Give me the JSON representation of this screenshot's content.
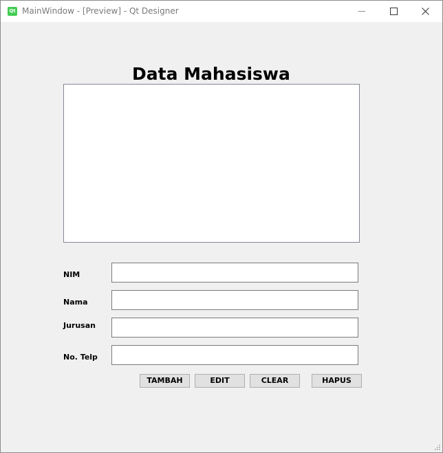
{
  "window": {
    "title": "MainWindow - [Preview] - Qt Designer",
    "app_icon_text": "Qt"
  },
  "form": {
    "heading": "Data Mahasiswa",
    "fields": [
      {
        "label": "NIM",
        "value": ""
      },
      {
        "label": "Nama",
        "value": ""
      },
      {
        "label": "Jurusan",
        "value": ""
      },
      {
        "label": "No. Telp",
        "value": ""
      }
    ],
    "buttons": {
      "tambah": "TAMBAH",
      "edit": "EDIT",
      "clear": "CLEAR",
      "hapus": "HAPUS"
    }
  },
  "colors": {
    "window_bg": "#f0f0f0",
    "titlebar_bg": "#ffffff",
    "qt_icon": "#41cd52",
    "button_bg": "#e1e1e1"
  },
  "icons": [
    "qt-app-icon",
    "minimize-icon",
    "maximize-icon",
    "close-icon",
    "size-grip-icon"
  ]
}
